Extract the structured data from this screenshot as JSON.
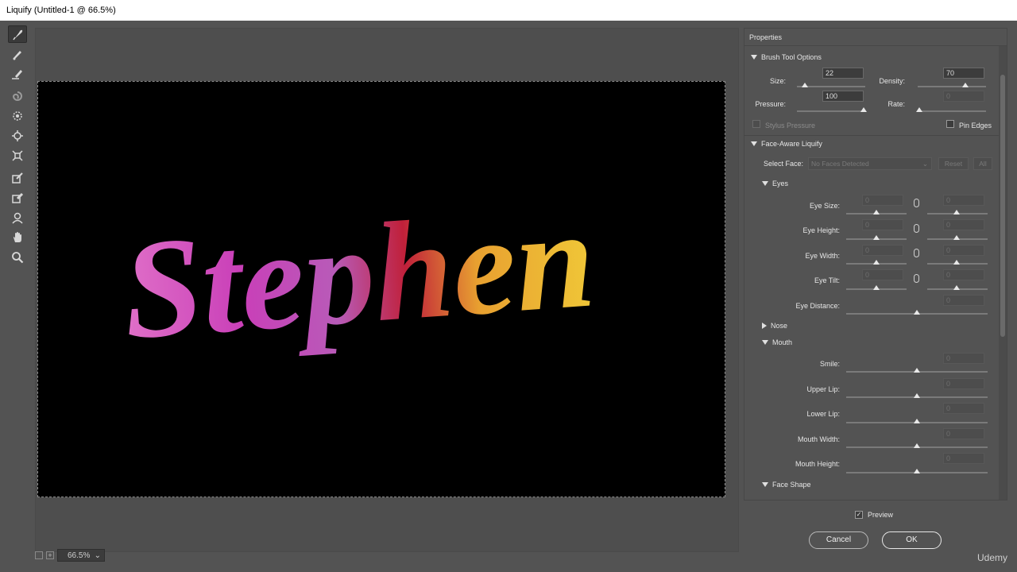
{
  "window": {
    "title": "Liquify (Untitled-1 @ 66.5%)"
  },
  "toolbar": {
    "tools": [
      {
        "name": "forward-warp-tool",
        "icon": "forward-warp-icon",
        "active": true
      },
      {
        "name": "reconstruct-tool",
        "icon": "reconstruct-brush-icon"
      },
      {
        "name": "smooth-tool",
        "icon": "smooth-brush-icon"
      },
      {
        "name": "twirl-clockwise-tool",
        "icon": "twirl-icon"
      },
      {
        "name": "pucker-tool",
        "icon": "pucker-icon"
      },
      {
        "name": "bloat-tool",
        "icon": "bloat-icon"
      },
      {
        "name": "push-left-tool",
        "icon": "push-left-icon"
      },
      {
        "name": "freeze-mask-tool",
        "icon": "freeze-mask-icon"
      },
      {
        "name": "thaw-mask-tool",
        "icon": "thaw-mask-icon"
      },
      {
        "name": "face-tool",
        "icon": "face-icon"
      },
      {
        "name": "hand-tool",
        "icon": "hand-icon"
      },
      {
        "name": "zoom-tool",
        "icon": "zoom-icon"
      }
    ]
  },
  "canvas": {
    "text": "Stephen"
  },
  "status": {
    "zoom": "66.5%"
  },
  "panel": {
    "title": "Properties",
    "brush": {
      "heading": "Brush Tool Options",
      "size_label": "Size:",
      "size_value": "22",
      "density_label": "Density:",
      "density_value": "70",
      "pressure_label": "Pressure:",
      "pressure_value": "100",
      "rate_label": "Rate:",
      "rate_value": "0",
      "stylus_label": "Stylus Pressure",
      "pin_edges_label": "Pin Edges"
    },
    "face": {
      "heading": "Face-Aware Liquify",
      "select_face_label": "Select Face:",
      "select_face_value": "No Faces Detected",
      "reset_label": "Reset",
      "all_label": "All",
      "eyes_heading": "Eyes",
      "eye_size": "Eye Size:",
      "eye_height": "Eye Height:",
      "eye_width": "Eye Width:",
      "eye_tilt": "Eye Tilt:",
      "eye_distance": "Eye Distance:",
      "zero": "0",
      "nose_heading": "Nose",
      "mouth_heading": "Mouth",
      "smile": "Smile:",
      "upper_lip": "Upper Lip:",
      "lower_lip": "Lower Lip:",
      "mouth_width": "Mouth Width:",
      "mouth_height": "Mouth Height:",
      "face_shape_heading": "Face Shape"
    }
  },
  "footer": {
    "preview_label": "Preview",
    "cancel_label": "Cancel",
    "ok_label": "OK",
    "watermark": "Udemy"
  },
  "colors": {
    "background": "#535353",
    "canvas": "#000000",
    "text_gradient": [
      "#d94fd0",
      "#c01080",
      "#f0c020"
    ]
  }
}
